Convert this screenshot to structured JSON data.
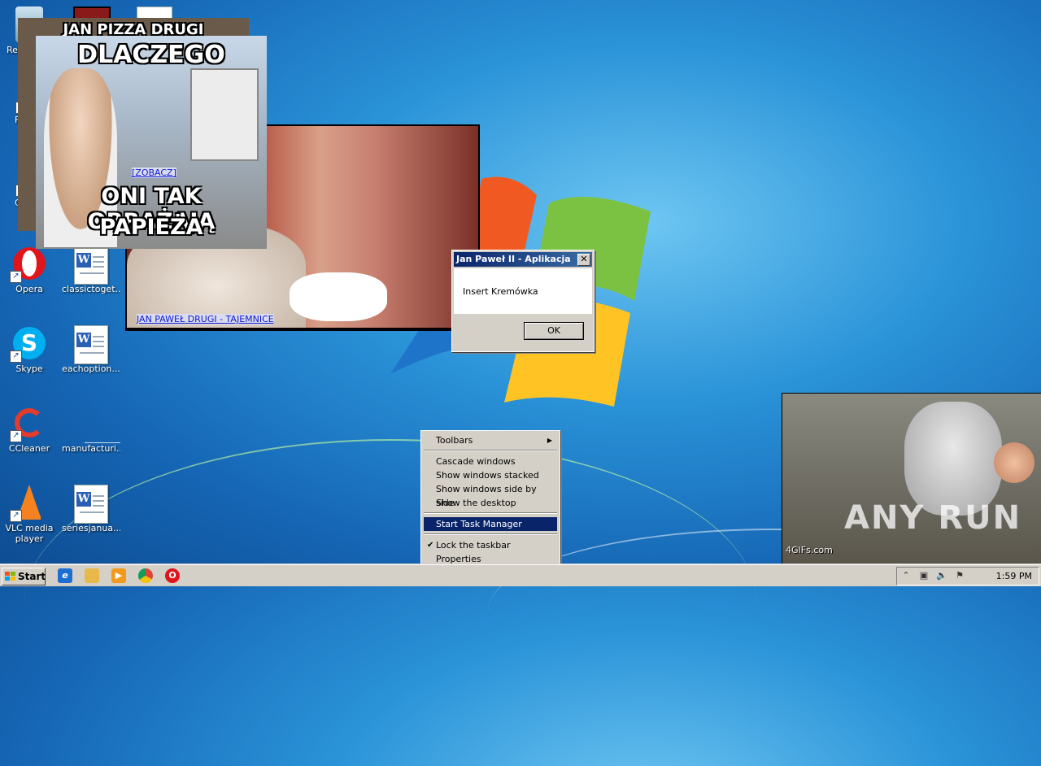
{
  "desktop": {
    "icons": [
      {
        "label": "Re"
      },
      {
        "label": "F"
      },
      {
        "label": "C"
      },
      {
        "label": "Opera"
      },
      {
        "label": "classictoget..."
      },
      {
        "label": "Skype"
      },
      {
        "label": "eachoption..."
      },
      {
        "label": "CCleaner"
      },
      {
        "label": "manufacturi..."
      },
      {
        "label": "VLC media player"
      },
      {
        "label": "seriesjanua..."
      }
    ]
  },
  "popups": {
    "meme": {
      "top_text": "DLACZEGO",
      "behind_text": "JAN PIZZA DRUGI",
      "bottom_text_1": "ONI TAK OBRAŻAJĄ",
      "bottom_text_2": "PAPIEŻA",
      "link": "[ZOBACZ]"
    },
    "video": {
      "link": "JAN PAWEŁ DRUGI - TAJEMNICE"
    },
    "gif": {
      "watermark": "ANY RUN",
      "source": "4GIFs.com"
    }
  },
  "dialog": {
    "title": "Jan Paweł II - Aplikacja",
    "message": "Insert Kremówka",
    "ok_label": "OK",
    "close_label": "✕"
  },
  "context_menu": {
    "items": [
      {
        "label": "Toolbars",
        "submenu": true
      },
      {
        "label": "Cascade windows"
      },
      {
        "label": "Show windows stacked"
      },
      {
        "label": "Show windows side by side"
      },
      {
        "label": "Show the desktop"
      },
      {
        "label": "Start Task Manager",
        "selected": true
      },
      {
        "label": "Lock the taskbar",
        "checked": true
      },
      {
        "label": "Properties"
      }
    ]
  },
  "taskbar": {
    "start_label": "Start",
    "clock": "1:59 PM",
    "quick_launch": [
      "internet-explorer-icon",
      "folder-icon",
      "media-player-icon",
      "chrome-icon",
      "opera-icon"
    ]
  }
}
